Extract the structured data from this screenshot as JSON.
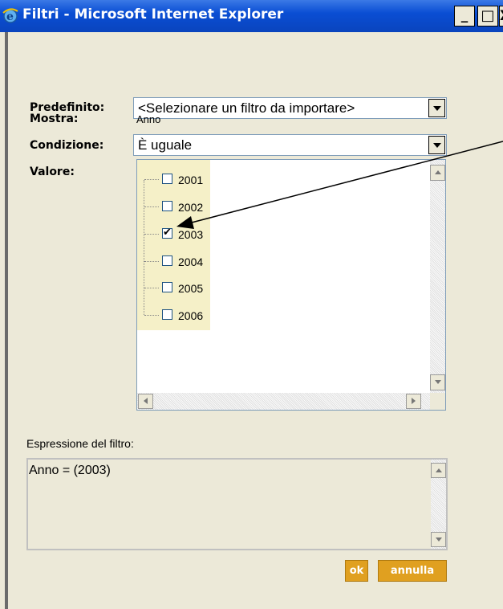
{
  "window": {
    "title": "Filtri - Microsoft Internet Explorer",
    "controls": {
      "minimize": "_",
      "maximize": "□",
      "close": "X"
    }
  },
  "form": {
    "predefinito_label": "Predefinito:",
    "predefinito_value": "<Selezionare un filtro da importare>",
    "mostra_label": "Mostra:",
    "mostra_value": "Anno",
    "condizione_label": "Condizione:",
    "condizione_value": "È uguale",
    "valore_label": "Valore:",
    "valori": [
      {
        "year": "2001",
        "checked": false
      },
      {
        "year": "2002",
        "checked": false
      },
      {
        "year": "2003",
        "checked": true
      },
      {
        "year": "2004",
        "checked": false
      },
      {
        "year": "2005",
        "checked": false
      },
      {
        "year": "2006",
        "checked": false
      }
    ],
    "espressione_label": "Espressione del filtro:",
    "espressione_value": "Anno = (2003)"
  },
  "buttons": {
    "ok": "ok",
    "annulla": "annulla"
  },
  "colors": {
    "titlebar": "#0a46c8",
    "button": "#e0a020",
    "tree_highlight": "#f5f0c8"
  }
}
